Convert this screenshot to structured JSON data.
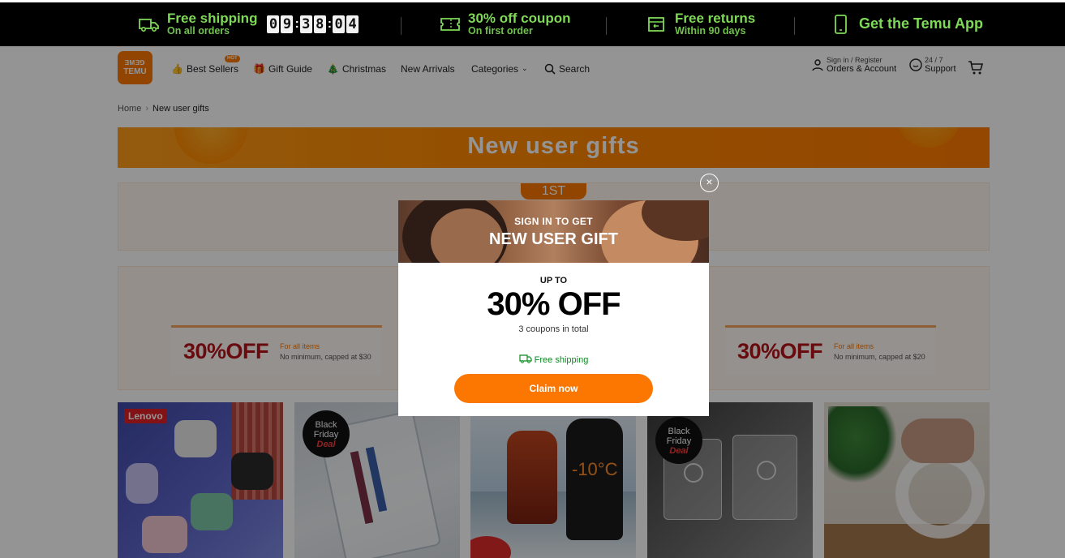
{
  "promo_bar": {
    "shipping_title": "Free shipping",
    "shipping_sub": "On all orders",
    "countdown": [
      "0",
      "9",
      "3",
      "8",
      "0",
      "4"
    ],
    "coupon_title": "30% off coupon",
    "coupon_sub": "On first order",
    "returns_title": "Free returns",
    "returns_sub": "Within 90 days",
    "app_label": "Get the Temu App"
  },
  "header": {
    "logo_top": "ƎMƎ⅁",
    "logo_text": "TEMU",
    "nav": {
      "best_sellers": "Best Sellers",
      "hot_badge": "HOT",
      "gift_guide": "Gift Guide",
      "christmas": "Christmas",
      "new_arrivals": "New Arrivals",
      "categories": "Categories",
      "search": "Search"
    },
    "account_small": "Sign in / Register",
    "account_big": "Orders & Account",
    "support_small": "24 / 7",
    "support_big": "Support"
  },
  "breadcrumb": {
    "home": "Home",
    "current": "New user gifts"
  },
  "banner": {
    "title": "New user gifts"
  },
  "panel": {
    "tab_label": "1ST"
  },
  "coupons": [
    {
      "value": "30%OFF",
      "for": "For all items",
      "min": "No minimum, capped at $30"
    },
    {
      "value": "30%OFF",
      "for": "For all items",
      "min": "No minimum, capped at $20"
    }
  ],
  "products": {
    "lenovo_badge": "Lenovo",
    "bf_line1": "Black",
    "bf_line2": "Friday",
    "bf_line3": "Deal",
    "gloves_label": "-10°C"
  },
  "modal": {
    "sign_in": "SIGN IN TO GET",
    "gift": "NEW USER GIFT",
    "up_to": "UP TO",
    "off": "30% OFF",
    "coupons_total": "3 coupons in total",
    "free_shipping": "Free shipping",
    "claim": "Claim now",
    "close": "×"
  },
  "colors": {
    "brand_orange": "#fb7701",
    "promo_green": "#7ed957",
    "coupon_red": "#b5121b",
    "free_ship_green": "#0a8a1f"
  }
}
